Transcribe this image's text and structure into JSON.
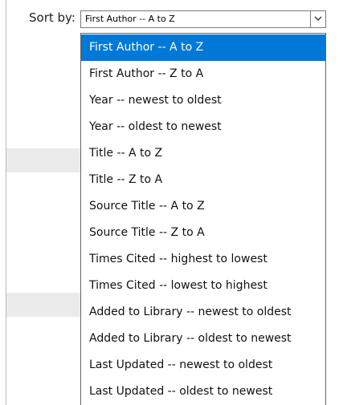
{
  "sort": {
    "label": "Sort by:",
    "selected_value": "First Author -- A to Z",
    "options": [
      "First Author -- A to Z",
      "First Author -- Z to A",
      "Year -- newest to oldest",
      "Year -- oldest to newest",
      "Title -- A to Z",
      "Title -- Z to A",
      "Source Title -- A to Z",
      "Source Title -- Z to A",
      "Times Cited -- highest to lowest",
      "Times Cited -- lowest to highest",
      "Added to Library -- newest to oldest",
      "Added to Library -- oldest to newest",
      "Last Updated -- newest to oldest",
      "Last Updated -- oldest to newest"
    ],
    "highlighted_option": "First Author -- A to Z",
    "dropdown_icon": "chevron-down-icon",
    "highlight_color": "#0078d7"
  }
}
